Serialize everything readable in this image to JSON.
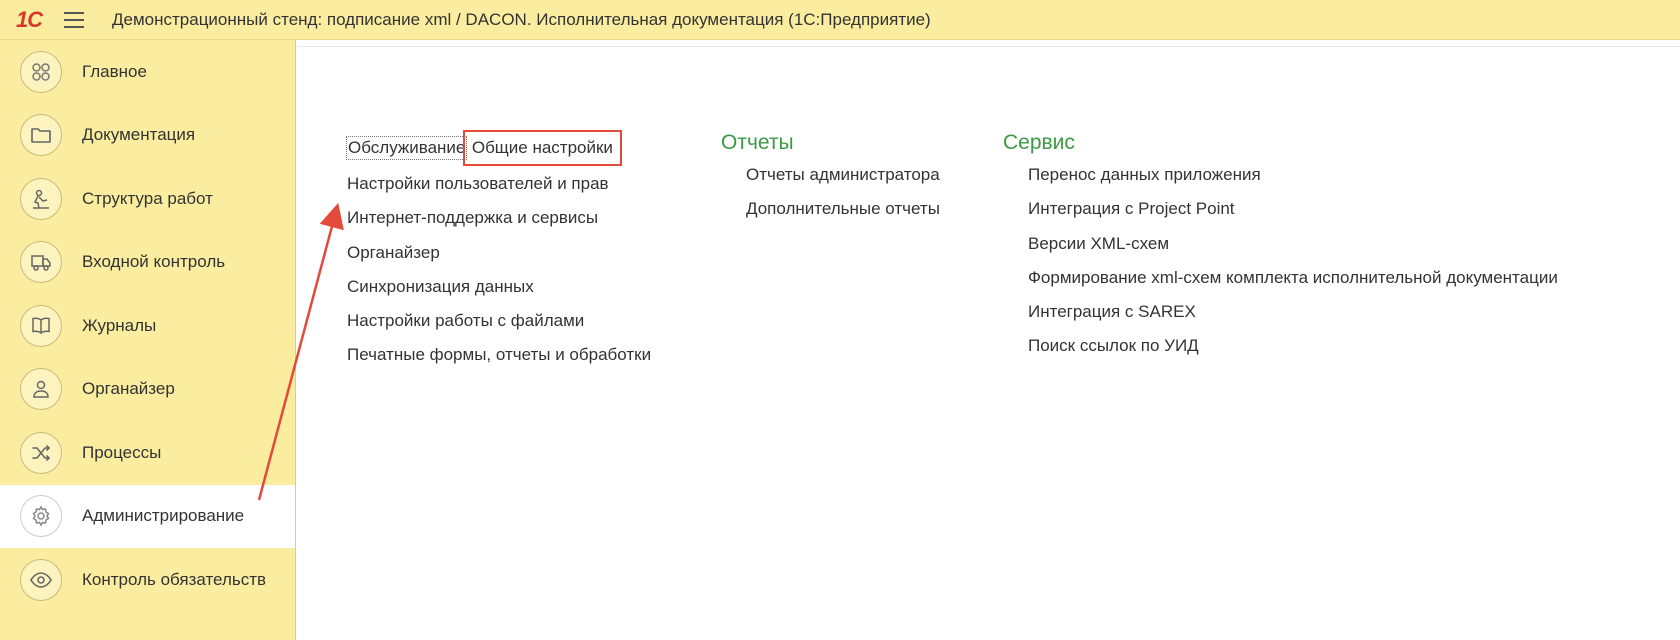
{
  "header": {
    "logo": "1С",
    "title": "Демонстрационный стенд: подписание xml / DACON. Исполнительная документация  (1С:Предприятие)"
  },
  "sidebar": {
    "items": [
      {
        "label": "Главное",
        "icon": "grid-icon"
      },
      {
        "label": "Документация",
        "icon": "folder-icon"
      },
      {
        "label": "Структура работ",
        "icon": "worker-icon"
      },
      {
        "label": "Входной контроль",
        "icon": "truck-icon"
      },
      {
        "label": "Журналы",
        "icon": "book-icon"
      },
      {
        "label": "Органайзер",
        "icon": "person-icon"
      },
      {
        "label": "Процессы",
        "icon": "shuffle-icon"
      },
      {
        "label": "Администрирование",
        "icon": "gear-icon",
        "active": true
      },
      {
        "label": "Контроль обязательств",
        "icon": "eye-icon"
      }
    ]
  },
  "main": {
    "col1": {
      "links": [
        "Обслуживание",
        "Общие настройки",
        "Настройки пользователей и прав",
        "Интернет-поддержка и сервисы",
        "Органайзер",
        "Синхронизация данных",
        "Настройки работы с файлами",
        "Печатные формы, отчеты и обработки"
      ]
    },
    "reports": {
      "title": "Отчеты",
      "links": [
        "Отчеты администратора",
        "Дополнительные отчеты"
      ]
    },
    "service": {
      "title": "Сервис",
      "links": [
        "Перенос данных приложения",
        "Интеграция с Project Point",
        "Версии XML-схем",
        "Формирование xml-схем комплекта исполнительной документации",
        "Интеграция с SAREX",
        "Поиск ссылок по УИД"
      ]
    }
  },
  "colors": {
    "header_bg": "#fbeda0",
    "section_title": "#3c9a45",
    "highlight": "#e24b3a"
  }
}
